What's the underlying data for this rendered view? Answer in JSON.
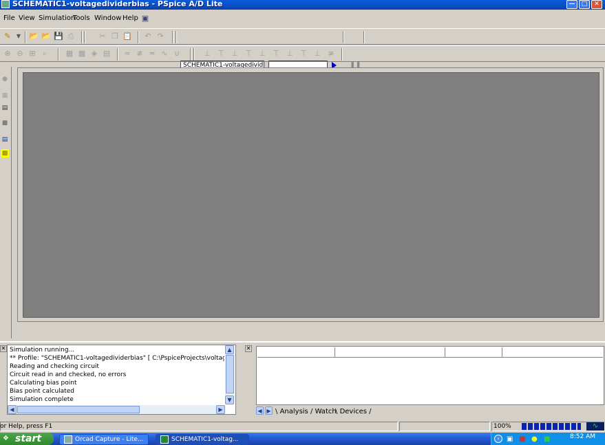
{
  "window": {
    "title": "SCHEMATIC1-voltagedividerbias - PSpice A/D Lite",
    "controls": [
      "minimize-icon",
      "maximize-icon",
      "close-icon"
    ]
  },
  "menu": {
    "items": [
      {
        "label": "File"
      },
      {
        "label": "View"
      },
      {
        "label": "Simulation"
      },
      {
        "label": "Tools"
      },
      {
        "label": "Window"
      },
      {
        "label": "Help"
      }
    ]
  },
  "toolbar": {
    "simulation_profile": "SCHEMATIC1-voltagedivid",
    "run_icon": "play-icon",
    "pause_icon": "pause-icon"
  },
  "output_window": {
    "lines": [
      "Simulation running...",
      "** Profile: \"SCHEMATIC1-voltagedividerbias\"  [ C:\\PspiceProjects\\voltage",
      "Reading and checking circuit",
      "Circuit read in and checked, no errors",
      "Calculating bias point",
      "Bias point calculated",
      "Simulation complete"
    ]
  },
  "watch_window": {
    "tabs": [
      {
        "label": "Analysis"
      },
      {
        "label": "Watch"
      },
      {
        "label": "Devices"
      }
    ]
  },
  "status_bar": {
    "help_text": "or Help, press F1",
    "zoom": "100%",
    "progress_percent": 100
  },
  "taskbar": {
    "start_label": "start",
    "buttons": [
      {
        "label": "Orcad Capture - Lite..."
      },
      {
        "label": "SCHEMATIC1-voltag..."
      }
    ],
    "clock": "8:52 AM"
  },
  "colors": {
    "titlebar": "#0a5bdc",
    "canvas": "#808080",
    "taskbar": "#245edb",
    "start": "#3c9a38",
    "progress": "#0a24b0"
  }
}
